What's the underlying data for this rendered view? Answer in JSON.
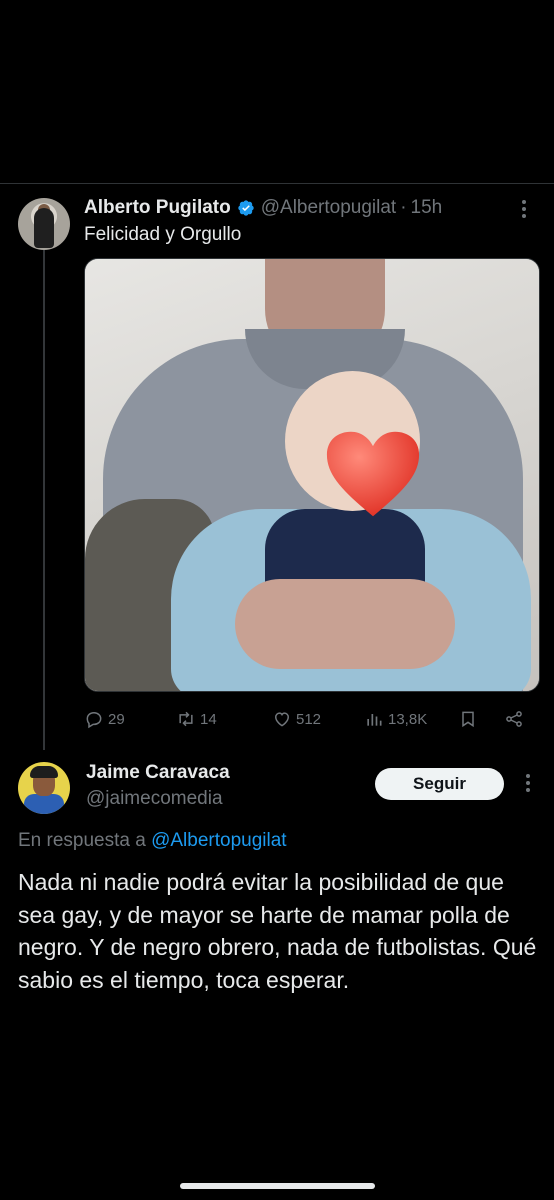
{
  "original_tweet": {
    "author_name": "Alberto Pugilato",
    "handle": "@Albertopugilat",
    "separator": "·",
    "time": "15h",
    "text": "Felicidad y Orgullo",
    "verified": true,
    "actions": {
      "replies": "29",
      "retweets": "14",
      "likes": "512",
      "views": "13,8K"
    }
  },
  "reply_tweet": {
    "author_name": "Jaime Caravaca",
    "handle": "@jaimecomedia",
    "follow_label": "Seguir",
    "in_reply_prefix": "En respuesta a",
    "in_reply_mention": "@Albertopugilat",
    "text": "Nada ni nadie podrá evitar la posibilidad de que sea gay, y de mayor se harte de mamar polla de negro. Y de negro obrero, nada de futbolistas. Qué sabio es el tiempo, toca esperar."
  },
  "colors": {
    "background": "#000000",
    "text": "#e7e9ea",
    "secondary": "#71767b",
    "link": "#1d9bf0",
    "verified": "#1d9bf0",
    "divider": "#2f3336"
  },
  "icons": {
    "verified": "verified-badge-icon",
    "more": "more-options-icon",
    "reply": "reply-icon",
    "retweet": "retweet-icon",
    "like": "heart-icon",
    "views": "views-bar-chart-icon",
    "bookmark": "bookmark-icon",
    "share": "share-icon"
  }
}
